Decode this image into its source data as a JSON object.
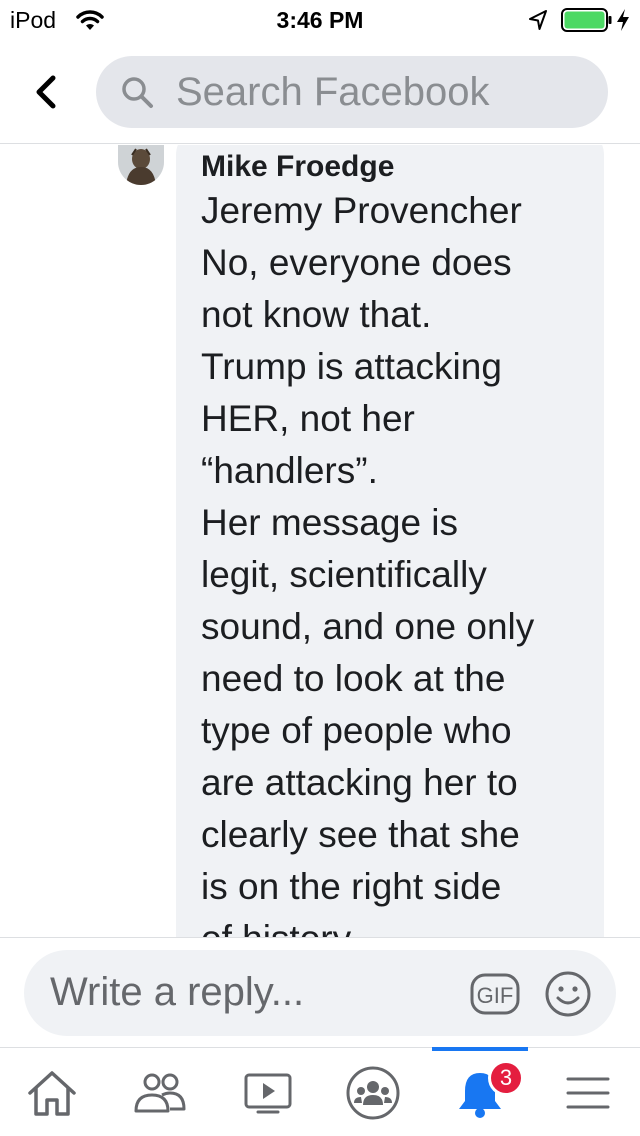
{
  "status_bar": {
    "carrier": "iPod",
    "time": "3:46 PM",
    "battery_color": "#4cd964"
  },
  "header": {
    "back_icon": "chevron-left-icon",
    "search": {
      "placeholder": "Search Facebook",
      "icon": "search-icon"
    }
  },
  "comment": {
    "author": "Mike Froedge",
    "lines": [
      "Jeremy Provencher",
      "No, everyone does",
      "not know that.",
      "Trump is attacking",
      "HER, not her",
      "“handlers”.",
      "Her message is",
      "legit, scientifically",
      "sound, and one only",
      "need to look at the",
      "type of people who",
      "are attacking her to",
      "clearly see that she",
      "is on the right side",
      "of history."
    ]
  },
  "reply": {
    "placeholder": "Write a reply...",
    "gif_label": "GIF",
    "emoji_icon": "smiley-icon"
  },
  "tabs": {
    "items": [
      {
        "name": "home",
        "icon": "home-icon"
      },
      {
        "name": "friends",
        "icon": "friends-icon"
      },
      {
        "name": "watch",
        "icon": "video-icon"
      },
      {
        "name": "groups",
        "icon": "groups-icon"
      },
      {
        "name": "notifications",
        "icon": "bell-icon",
        "active": true,
        "badge": "3"
      },
      {
        "name": "menu",
        "icon": "hamburger-icon"
      }
    ],
    "accent_color": "#1877f2",
    "badge_color": "#e41e3f"
  }
}
